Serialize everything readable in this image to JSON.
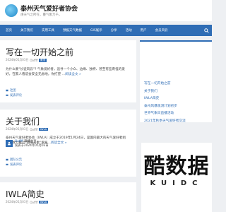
{
  "header": {
    "site_title": "泰州天气爱好者协会",
    "site_description": "虔天气之所在，蔓气象万千。"
  },
  "nav": {
    "items": [
      {
        "label": "首页",
        "name": "nav-home"
      },
      {
        "label": "关于我们",
        "name": "nav-about"
      },
      {
        "label": "实用工具",
        "name": "nav-tools"
      },
      {
        "label": "预报天气数据",
        "name": "nav-forecast"
      },
      {
        "label": "GIS展示",
        "name": "nav-gis"
      },
      {
        "label": "分享",
        "name": "nav-share"
      },
      {
        "label": "活动",
        "name": "nav-events"
      },
      {
        "label": "用户",
        "name": "nav-user"
      },
      {
        "label": "会员风云",
        "name": "nav-members"
      }
    ],
    "search_icon": "search-icon"
  },
  "posts": [
    {
      "title": "写在一切开始之前",
      "date": "2024年05月03日",
      "author": "Ooffff",
      "badge": "置顶",
      "excerpt": "为什么要\"长徒风云\"? 气象爱好者，追寻一个小众、边缘、独特、甚至有些奇怪的爱好，在家人看说会安全无虑地，你打望 …",
      "read_more": "阅读全文 »",
      "category": "社团",
      "comments": "发表评论"
    },
    {
      "title": "关于我们",
      "date": "2024年05月03日",
      "author": "Ooffff",
      "badge": "IWLA",
      "excerpt": "泰州天气爱好者协会（IWLA）成立于2019年1月24日，是国内最大的天气爱好者组织，致力推动\"明晴天象\"发展…",
      "read_more": "阅读全文 »",
      "category": "团队公告",
      "comments": "发表评论",
      "author_box": {
        "name": "Ooffff",
        "role": "微博主页",
        "note": "发表于2024年05月03日"
      }
    },
    {
      "title": "IWLA简史",
      "date": "2024年05月03日",
      "author": "Ooffff",
      "badge": "IWLA"
    }
  ],
  "sidebar": {
    "links": [
      "写在一切开始之前",
      "关于我们",
      "IWLA简史",
      "泰州风暴观测计划初步",
      "世界气象日直播活动",
      "2021年秋季天气爱好者交流"
    ]
  },
  "watermark": {
    "text": "酷数据",
    "sub": "KUIDC"
  },
  "colors": {
    "accent": "#2f6db5",
    "background": "#eef0f3"
  }
}
